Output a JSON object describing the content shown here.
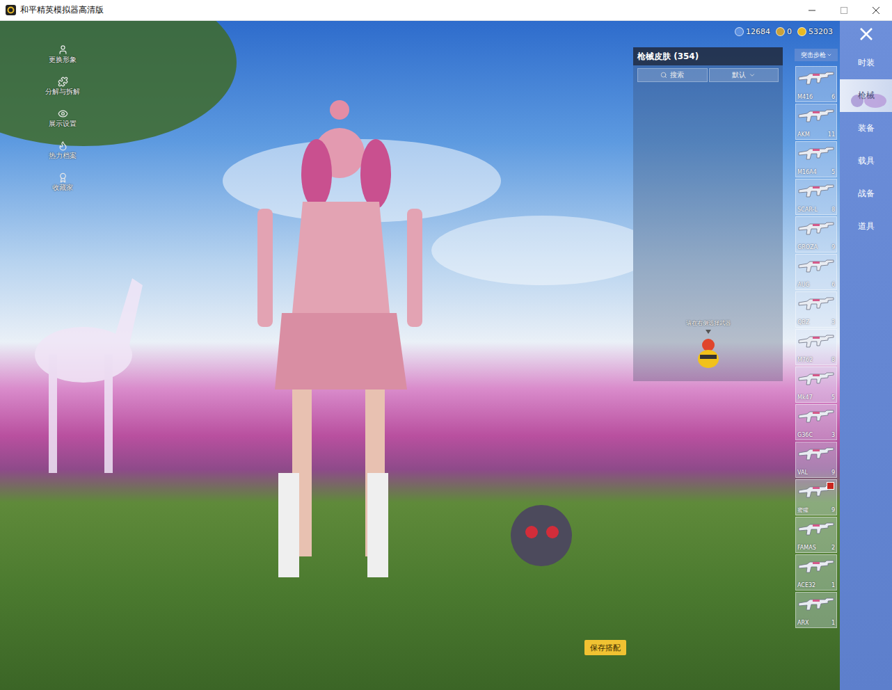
{
  "window": {
    "title": "和平精英模拟器高清版"
  },
  "currencies": [
    {
      "amount": "12684",
      "color": "#5b8fe0"
    },
    {
      "amount": "0",
      "color": "#c9a13a"
    },
    {
      "amount": "53203",
      "color": "#e8b923"
    }
  ],
  "side_menu": [
    {
      "label": "更换形象"
    },
    {
      "label": "分解与拆解"
    },
    {
      "label": "展示设置"
    },
    {
      "label": "热力档案"
    },
    {
      "label": "收藏家"
    }
  ],
  "panel": {
    "title": "枪械皮肤 (354)",
    "search": {
      "placeholder": "搜索"
    },
    "sort": {
      "value": "默认"
    },
    "hint": "请在右侧选择武器"
  },
  "category": {
    "value": "突击步枪"
  },
  "weapons": [
    {
      "name": "M416",
      "count": "6",
      "selected": false,
      "badge": false
    },
    {
      "name": "AKM",
      "count": "11",
      "selected": false,
      "badge": false
    },
    {
      "name": "M16A4",
      "count": "5",
      "selected": false,
      "badge": false
    },
    {
      "name": "SCAR-L",
      "count": "8",
      "selected": false,
      "badge": false
    },
    {
      "name": "GROZA",
      "count": "9",
      "selected": false,
      "badge": false
    },
    {
      "name": "AUG",
      "count": "6",
      "selected": false,
      "badge": false
    },
    {
      "name": "QBZ",
      "count": "3",
      "selected": false,
      "badge": false
    },
    {
      "name": "M762",
      "count": "8",
      "selected": false,
      "badge": false
    },
    {
      "name": "Mk47",
      "count": "5",
      "selected": false,
      "badge": false
    },
    {
      "name": "G36C",
      "count": "3",
      "selected": false,
      "badge": false
    },
    {
      "name": "VAL",
      "count": "9",
      "selected": false,
      "badge": false
    },
    {
      "name": "蜜獾",
      "count": "9",
      "selected": false,
      "badge": true
    },
    {
      "name": "FAMAS",
      "count": "2",
      "selected": false,
      "badge": false
    },
    {
      "name": "ACE32",
      "count": "1",
      "selected": false,
      "badge": false
    },
    {
      "name": "ARX",
      "count": "1",
      "selected": false,
      "badge": false
    }
  ],
  "tabs": [
    {
      "label": "时装",
      "selected": false
    },
    {
      "label": "枪械",
      "selected": true
    },
    {
      "label": "装备",
      "selected": false
    },
    {
      "label": "载具",
      "selected": false
    },
    {
      "label": "战备",
      "selected": false
    },
    {
      "label": "道具",
      "selected": false
    }
  ],
  "save_button": "保存搭配"
}
